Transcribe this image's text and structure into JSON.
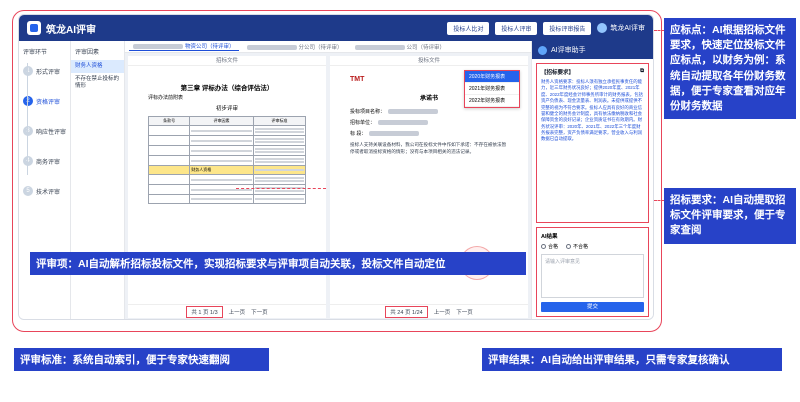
{
  "app": {
    "title": "筑龙AI评审",
    "top_buttons": [
      "投标人比对",
      "投标人评审",
      "投标评审报告"
    ],
    "user": "筑龙AI评审"
  },
  "stepnav": {
    "title": "评审环节",
    "steps": [
      {
        "num": "1",
        "label": "形式评审"
      },
      {
        "num": "2",
        "label": "资格评审"
      },
      {
        "num": "3",
        "label": "响应性评审"
      },
      {
        "num": "4",
        "label": "商务评审"
      },
      {
        "num": "5",
        "label": "技术评审"
      }
    ]
  },
  "subnav": {
    "title": "评审因素",
    "items": [
      "财务人资格",
      "不存在禁止投标的情形"
    ]
  },
  "company_tabs": [
    "物资公司（待评审）",
    "分公司（待评审）",
    "公司（待评审）"
  ],
  "left_panel": {
    "header": "招标文件",
    "chapter": "第三章 评标办法（综合评估法）",
    "table_title": "评标办法前附表",
    "section": "初步评审",
    "table_headers": [
      "条款号",
      "评审因素",
      "评审标准"
    ],
    "highlight_row": "财务人资格",
    "pager": {
      "label": "共 1 页",
      "current": "1/3",
      "prev": "上一页",
      "next": "下一页"
    }
  },
  "right_panel": {
    "header": "投标文件",
    "logo": "TMT",
    "to_label": "承诺书",
    "lines": [
      "投标项目名称：",
      "招标单位：",
      "标 段："
    ],
    "para": "投标人支持关联设备材料，我公司在投标文件中作如下承诺：不存在被依法暂停或者取消投标资格的情形；没有与本项目相关的违法记录。",
    "pager": {
      "label": "共 24 页",
      "current": "1/24",
      "prev": "上一页",
      "next": "下一页"
    }
  },
  "year_dropdown": [
    "2020年财务报表",
    "2021年财务报表",
    "2022年财务报表"
  ],
  "ai_panel": {
    "title": "AI评审助手",
    "analysis_title": "【招标要求】",
    "analysis_text": "财务人资格要求：投标人须有独立承担民事责任的能力，近三年财务状况良好；提供2020年度、2021年度、2022年度经会计师事务所审计的财务报表，包括资产负债表、现金流量表、利润表。未提供或提供不完整的视为不符合要求。投标人应具有良好的商业信誉和健全的财务会计制度，具有依法缴纳税收和社会保障资金的良好记录；企业资质证书在有效期内。财务状况评审：2020年、2021年、2022年三个年度财务报表完整，资产负债率满足要求，营业收入与利润数据已自动提取。",
    "result_label": "AI结果",
    "options": [
      "合格",
      "不合格"
    ],
    "textarea_placeholder": "请输入评审意见",
    "submit": "提交"
  },
  "callouts": {
    "answer_point": "应标点：AI根据招标文件要求，快速定位投标文件应标点，以财务为例：系统自动提取各年份财务数据，便于专家查看对应年份财务数据",
    "tender_req": "招标要求：AI自动提取招标文件评审要求，便于专家查阅",
    "review_item": "评审项：AI自动解析招标投标文件，实现招标要求与评审项自动关联，投标文件自动定位",
    "review_std": "评审标准：系统自动索引，便于专家快速翻阅",
    "review_result": "评审结果：AI自动给出评审结果，只需专家复核确认"
  }
}
